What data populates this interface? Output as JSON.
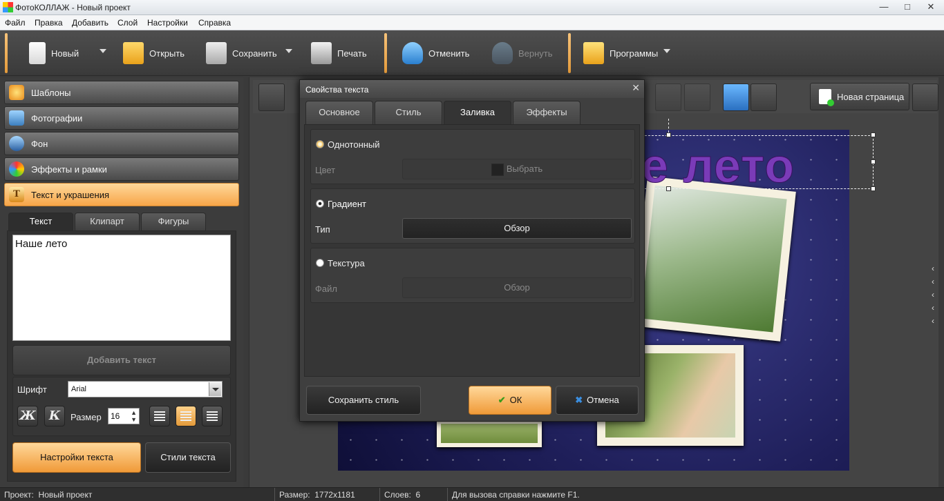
{
  "window": {
    "title": "ФотоКОЛЛАЖ - Новый проект",
    "minimize": "—",
    "maximize": "□",
    "close": "✕"
  },
  "menu": [
    "Файл",
    "Правка",
    "Добавить",
    "Слой",
    "Настройки",
    "Справка"
  ],
  "toolbar": {
    "new_label": "Новый",
    "open_label": "Открыть",
    "save_label": "Сохранить",
    "print_label": "Печать",
    "undo_label": "Отменить",
    "redo_label": "Вернуть",
    "programs_label": "Программы"
  },
  "sidebar": {
    "items": [
      {
        "label": "Шаблоны",
        "icon": "star-icon"
      },
      {
        "label": "Фотографии",
        "icon": "photos-icon"
      },
      {
        "label": "Фон",
        "icon": "paint-icon"
      },
      {
        "label": "Эффекты и рамки",
        "icon": "palette-icon"
      },
      {
        "label": "Текст и украшения",
        "icon": "text-icon"
      }
    ],
    "active_index": 4
  },
  "text_panel": {
    "tabs": [
      "Текст",
      "Клипарт",
      "Фигуры"
    ],
    "active_tab": 0,
    "text_value": "Наше лето",
    "add_text_label": "Добавить текст",
    "font_label": "Шрифт",
    "font_value": "Arial",
    "bold_glyph": "Ж",
    "italic_glyph": "К",
    "size_label": "Размер",
    "size_value": "16",
    "settings_button": "Настройки текста",
    "styles_button": "Стили текста"
  },
  "workarea": {
    "new_page_label": "Новая страница",
    "heading_text": "е лето",
    "expand_arrows": "‹\n‹\n‹\n‹\n‹"
  },
  "dialog": {
    "title": "Свойства текста",
    "close": "✕",
    "tabs": [
      "Основное",
      "Стиль",
      "Заливка",
      "Эффекты"
    ],
    "active_tab": 2,
    "solid": {
      "label": "Однотонный",
      "field_label": "Цвет",
      "button": "Выбрать"
    },
    "gradient": {
      "label": "Градиент",
      "field_label": "Тип",
      "button": "Обзор"
    },
    "texture": {
      "label": "Текстура",
      "field_label": "Файл",
      "button": "Обзор"
    },
    "selected_fill": "Градиент",
    "save_style": "Сохранить стиль",
    "ok": "ОК",
    "cancel": "Отмена"
  },
  "status": {
    "project_label": "Проект:",
    "project_value": "Новый проект",
    "size_label": "Размер:",
    "size_value": "1772x1181",
    "layers_label": "Слоев:",
    "layers_value": "6",
    "help": "Для вызова справки нажмите F1."
  },
  "colors": {
    "accent": "#f7a548",
    "dark": "#3a3a3a",
    "heading": "#7a3bb8"
  }
}
